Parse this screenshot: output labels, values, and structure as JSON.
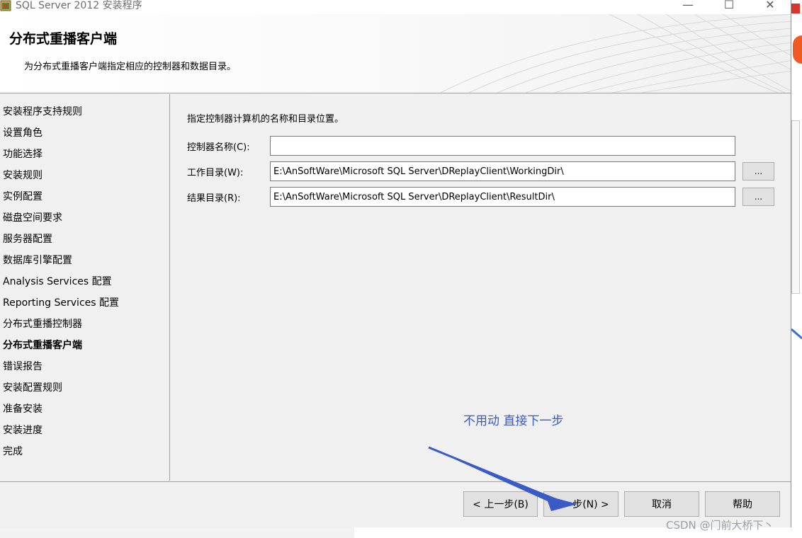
{
  "window": {
    "title": "SQL Server 2012 安装程序",
    "controls": {
      "minimize": "—",
      "maximize": "☐",
      "close": "✕"
    }
  },
  "header": {
    "title": "分布式重播客户端",
    "subtitle": "为分布式重播客户端指定相应的控制器和数据目录。"
  },
  "sidebar": {
    "items": [
      {
        "label": "安装程序支持规则",
        "active": false
      },
      {
        "label": "设置角色",
        "active": false
      },
      {
        "label": "功能选择",
        "active": false
      },
      {
        "label": "安装规则",
        "active": false
      },
      {
        "label": "实例配置",
        "active": false
      },
      {
        "label": "磁盘空间要求",
        "active": false
      },
      {
        "label": "服务器配置",
        "active": false
      },
      {
        "label": "数据库引擎配置",
        "active": false
      },
      {
        "label": "Analysis Services 配置",
        "active": false
      },
      {
        "label": "Reporting Services 配置",
        "active": false
      },
      {
        "label": "分布式重播控制器",
        "active": false
      },
      {
        "label": "分布式重播客户端",
        "active": true
      },
      {
        "label": "错误报告",
        "active": false
      },
      {
        "label": "安装配置规则",
        "active": false
      },
      {
        "label": "准备安装",
        "active": false
      },
      {
        "label": "安装进度",
        "active": false
      },
      {
        "label": "完成",
        "active": false
      }
    ]
  },
  "content": {
    "instruction": "指定控制器计算机的名称和目录位置。",
    "controller": {
      "label": "控制器名称(C):",
      "value": ""
    },
    "working_dir": {
      "label": "工作目录(W):",
      "value": "E:\\AnSoftWare\\Microsoft SQL Server\\DReplayClient\\WorkingDir\\"
    },
    "result_dir": {
      "label": "结果目录(R):",
      "value": "E:\\AnSoftWare\\Microsoft SQL Server\\DReplayClient\\ResultDir\\"
    },
    "browse_label": "..."
  },
  "annotation": {
    "text": "不用动  直接下一步",
    "color": "#3a5bc7"
  },
  "footer": {
    "back": "< 上一步(B)",
    "next": "下一步(N) >",
    "cancel": "取消",
    "help": "帮助"
  },
  "watermark": "CSDN @门前大桥下丶"
}
